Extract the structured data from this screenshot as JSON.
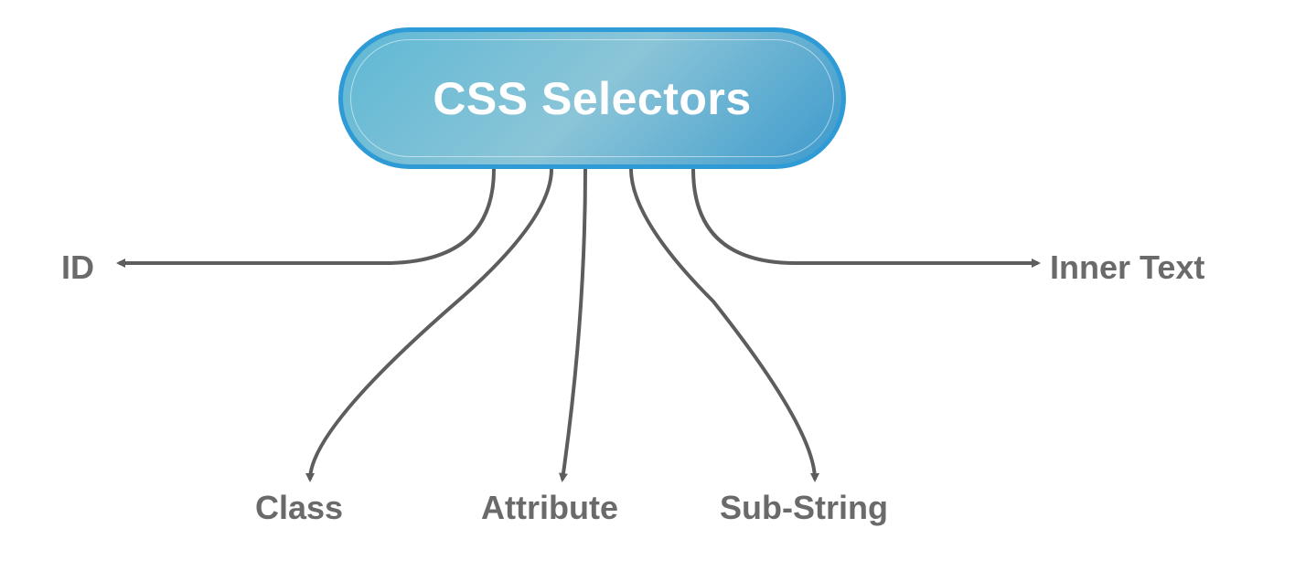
{
  "root": {
    "title": "CSS Selectors"
  },
  "branches": {
    "id": "ID",
    "class": "Class",
    "attribute": "Attribute",
    "substring": "Sub-String",
    "innertext": "Inner Text"
  },
  "colors": {
    "node_border": "#2e9bd6",
    "node_gradient_start": "#5fb8d4",
    "node_gradient_end": "#8bc5d8",
    "arrow": "#5d5d5d",
    "label": "#6a6a6a"
  }
}
